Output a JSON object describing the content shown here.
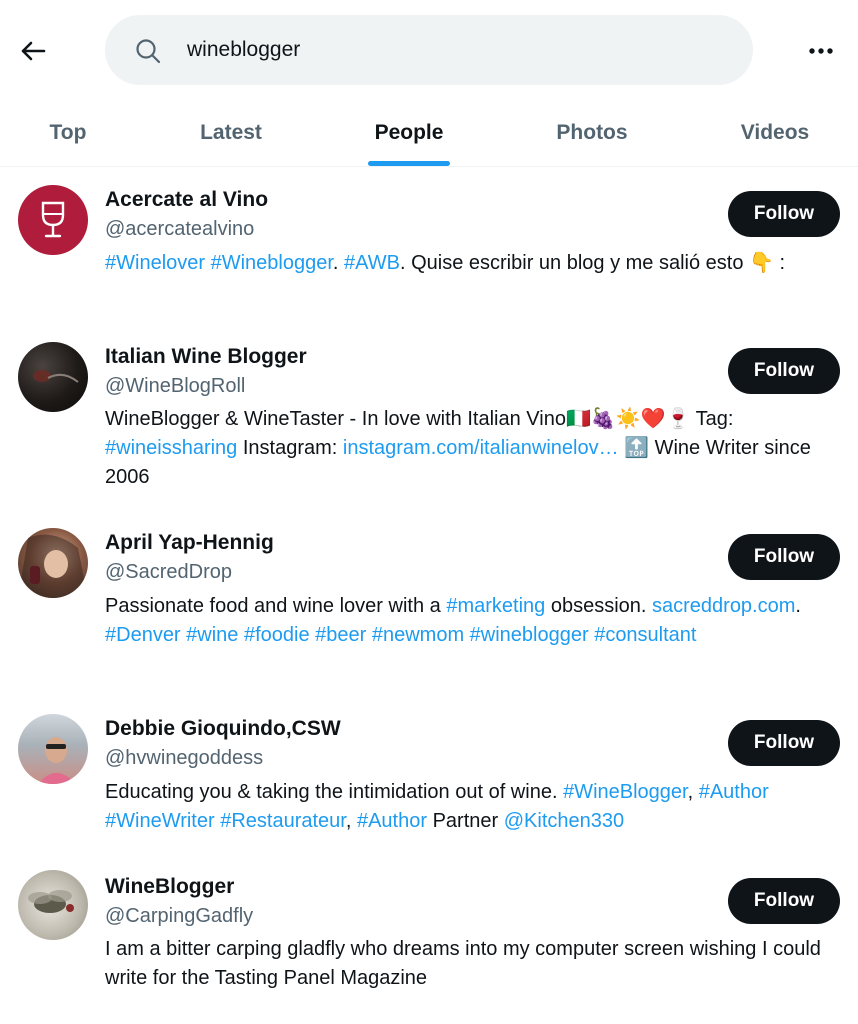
{
  "search": {
    "query": "wineblogger"
  },
  "tabs": [
    {
      "label": "Top"
    },
    {
      "label": "Latest"
    },
    {
      "label": "People",
      "active": true
    },
    {
      "label": "Photos"
    },
    {
      "label": "Videos"
    }
  ],
  "users": [
    {
      "name": "Acercate al Vino",
      "handle": "@acercatealvino",
      "follow_label": "Follow",
      "bio": {
        "p1": "#Winelover",
        "p2": " ",
        "p3": "#Wineblogger",
        "p4": ". ",
        "p5": "#AWB",
        "p6": ". Quise escribir un blog y me salió esto ",
        "p7": "👇",
        "p8": " :"
      }
    },
    {
      "name": "Italian Wine Blogger",
      "handle": "@WineBlogRoll",
      "follow_label": "Follow",
      "bio": {
        "p1": "WineBlogger & WineTaster - In love with Italian Vino",
        "p2": "🇮🇹🍇☀️❤️🍷",
        "p3": " Tag: ",
        "p4": "#wineissharing",
        "p5": " Instagram: ",
        "p6": "instagram.com/italianwinelov…",
        "p7": " 🔝",
        "p8": " Wine Writer since 2006"
      }
    },
    {
      "name": "April Yap-Hennig",
      "handle": "@SacredDrop",
      "follow_label": "Follow",
      "bio": {
        "p1": "Passionate food and wine lover with a ",
        "p2": "#marketing",
        "p3": " obsession. ",
        "p4": "sacreddrop.com",
        "p5": ". ",
        "p6": "#Denver #wine #foodie #beer #newmom #wineblogger #consultant"
      }
    },
    {
      "name": "Debbie Gioquindo,CSW",
      "handle": "@hvwinegoddess",
      "follow_label": "Follow",
      "bio": {
        "p1": "Educating you & taking the intimidation out of wine. ",
        "p2": "#WineBlogger",
        "p3": ", ",
        "p4": "#Author #WineWriter #Restaurateur",
        "p5": ", ",
        "p6": "#Author",
        "p7": " Partner ",
        "p8": "@Kitchen330"
      }
    },
    {
      "name": "WineBlogger",
      "handle": "@CarpingGadfly",
      "follow_label": "Follow",
      "bio": {
        "p1": "I am a bitter carping gladfly who dreams into my computer screen wishing I could write for the Tasting Panel Magazine"
      }
    }
  ]
}
